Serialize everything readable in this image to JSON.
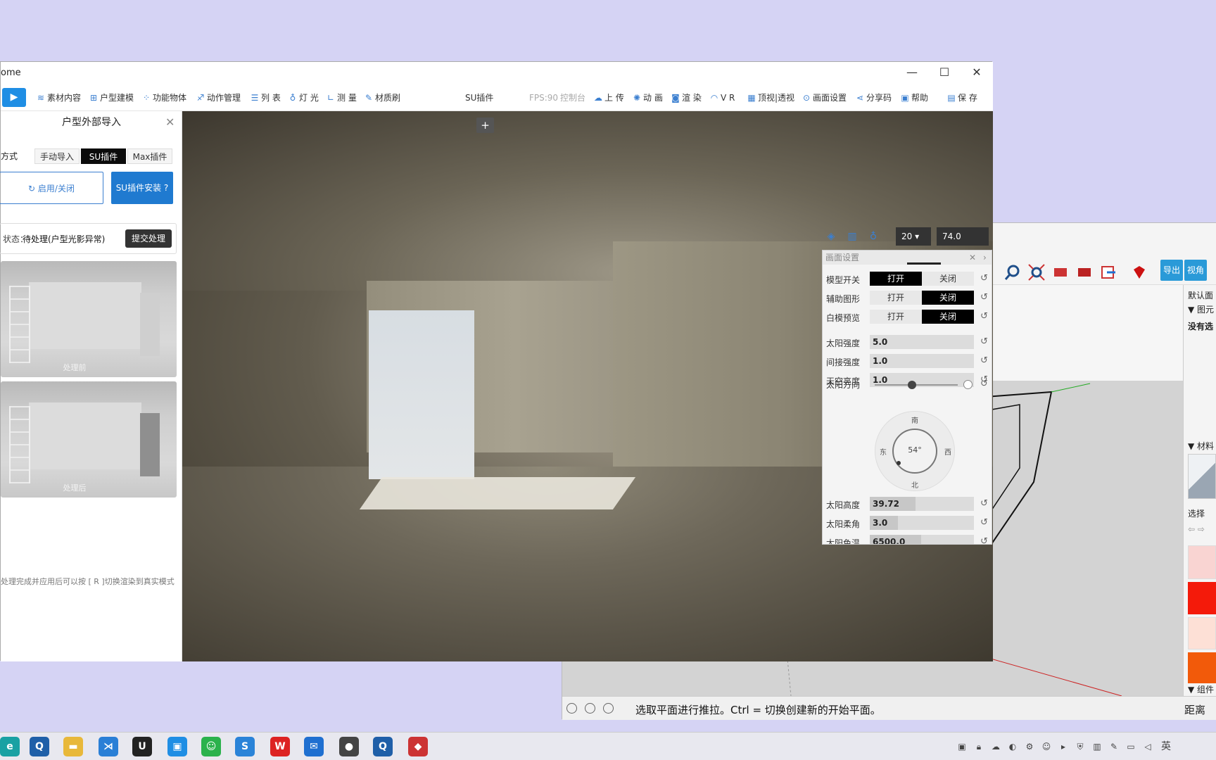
{
  "app": {
    "title": "ome"
  },
  "toolbar": {
    "items": [
      "素材内容",
      "户型建模",
      "功能物体",
      "动作管理",
      "列 表",
      "灯 光",
      "测 量",
      "材质刷"
    ],
    "center_label": "SU插件",
    "fps": "FPS:90",
    "console": "控制台",
    "right_items": [
      "上 传",
      "动 画",
      "渲 染",
      "V R",
      "顶视|透视",
      "画面设置",
      "分享码",
      "帮助",
      "保 存"
    ]
  },
  "panel": {
    "title": "户型外部导入",
    "mode_label": "方式",
    "modes": [
      "手动导入",
      "SU插件",
      "Max插件"
    ],
    "toggle_label": "启用/关闭",
    "install_label": "SU插件安装",
    "status_label": "状态：",
    "status_value": "待处理(户型光影异常)",
    "submit_label": "提交处理",
    "before_caption": "处理前",
    "after_caption": "处理后",
    "hint": "处理完成并应用后可以按 [ R ]切换渲染到真实模式"
  },
  "viewport": {
    "add_label": "+",
    "view_count": "20",
    "view_value": "74.0"
  },
  "settings": {
    "title": "画面设置",
    "toggles": [
      {
        "label": "模型开关",
        "on": "打开",
        "off": "关闭",
        "selected": "on"
      },
      {
        "label": "辅助图形",
        "on": "打开",
        "off": "关闭",
        "selected": "off"
      },
      {
        "label": "白模预览",
        "on": "打开",
        "off": "关闭",
        "selected": "off"
      }
    ],
    "bars": [
      {
        "label": "太阳强度",
        "value": "5.0",
        "fill": 0.0
      },
      {
        "label": "间接强度",
        "value": "1.0",
        "fill": 0.0
      },
      {
        "label": "天空亮度",
        "value": "1.0",
        "fill": 0.0
      }
    ],
    "sun_direction": {
      "label": "太阳方向",
      "slider": 0.45,
      "angle": "54°",
      "south": "南",
      "north": "北",
      "east": "东",
      "west": "西"
    },
    "bars2": [
      {
        "label": "太阳高度",
        "value": "39.72",
        "fill": 0.44
      },
      {
        "label": "太阳柔角",
        "value": "3.0",
        "fill": 0.27
      },
      {
        "label": "太阳色温",
        "value": "6500.0",
        "fill": 0.49
      }
    ]
  },
  "sketchup": {
    "export_label": "导出",
    "view_label": "视角",
    "tray": {
      "default": "默认面",
      "item1": "▼ 图元",
      "item2": "没有选",
      "materials": "▼ 材料",
      "select": "选择",
      "group": "▼ 组件"
    },
    "status_message": "选取平面进行推拉。Ctrl = 切换创建新的开始平面。",
    "distance": "距离"
  },
  "taskbar": {
    "ime": "英",
    "app_icons": [
      "edge-icon",
      "q-icon",
      "folder-icon",
      "vscode-icon",
      "unreal-icon",
      "calendar-icon",
      "wechat-icon",
      "app-icon",
      "wps-icon",
      "mail-icon",
      "record-icon",
      "q2-icon",
      "ruby-icon"
    ]
  }
}
